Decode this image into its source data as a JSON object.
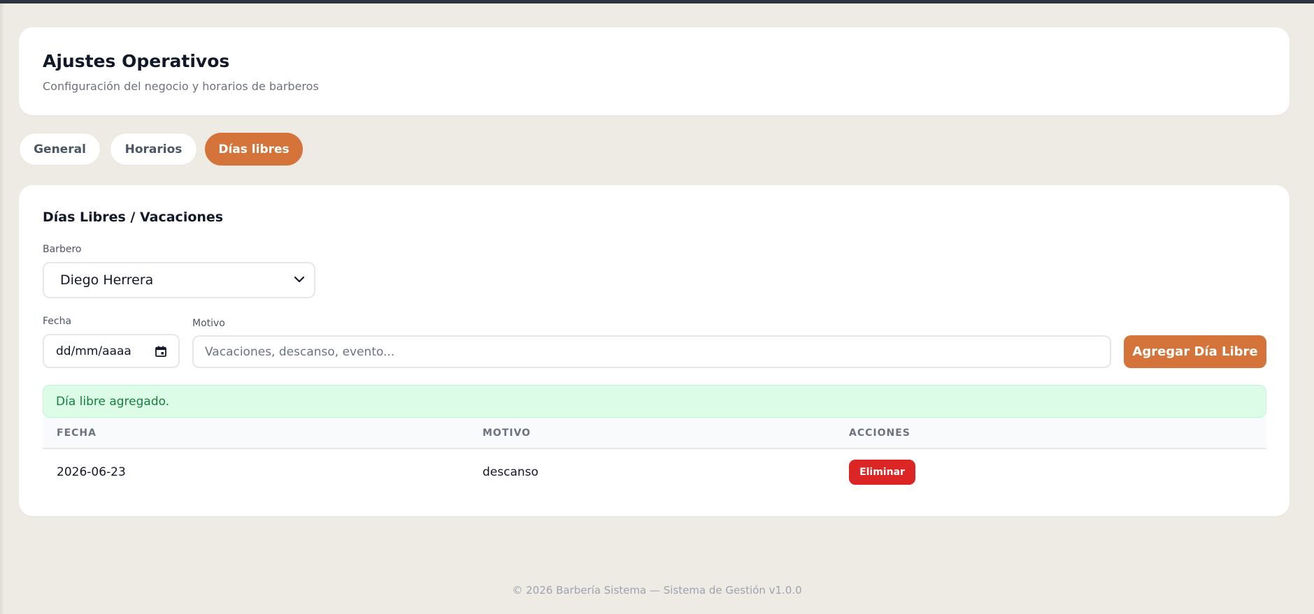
{
  "header": {
    "title": "Ajustes Operativos",
    "subtitle": "Configuración del negocio y horarios de barberos"
  },
  "tabs": [
    {
      "label": "General",
      "active": false
    },
    {
      "label": "Horarios",
      "active": false
    },
    {
      "label": "Días libres",
      "active": true
    }
  ],
  "section": {
    "title": "Días Libres / Vacaciones"
  },
  "form": {
    "barber_label": "Barbero",
    "barber_value": "Diego Herrera",
    "date_label": "Fecha",
    "date_placeholder": "dd/mm/aaaa",
    "reason_label": "Motivo",
    "reason_placeholder": "Vacaciones, descanso, evento...",
    "submit_label": "Agregar Día Libre"
  },
  "alert": {
    "message": "Día libre agregado."
  },
  "table": {
    "columns": [
      "FECHA",
      "MOTIVO",
      "ACCIONES"
    ],
    "rows": [
      {
        "fecha": "2026-06-23",
        "motivo": "descanso",
        "action_label": "Eliminar"
      }
    ]
  },
  "footer": {
    "text": "© 2026 Barbería Sistema — Sistema de Gestión v1.0.0"
  },
  "colors": {
    "accent": "#d5743a",
    "danger": "#dc2626",
    "success_bg": "#dcfce7",
    "success_text": "#15803d",
    "background": "#eeebe5"
  },
  "icons": {
    "select_arrow": "chevron-down-icon",
    "date_picker": "calendar-icon"
  }
}
